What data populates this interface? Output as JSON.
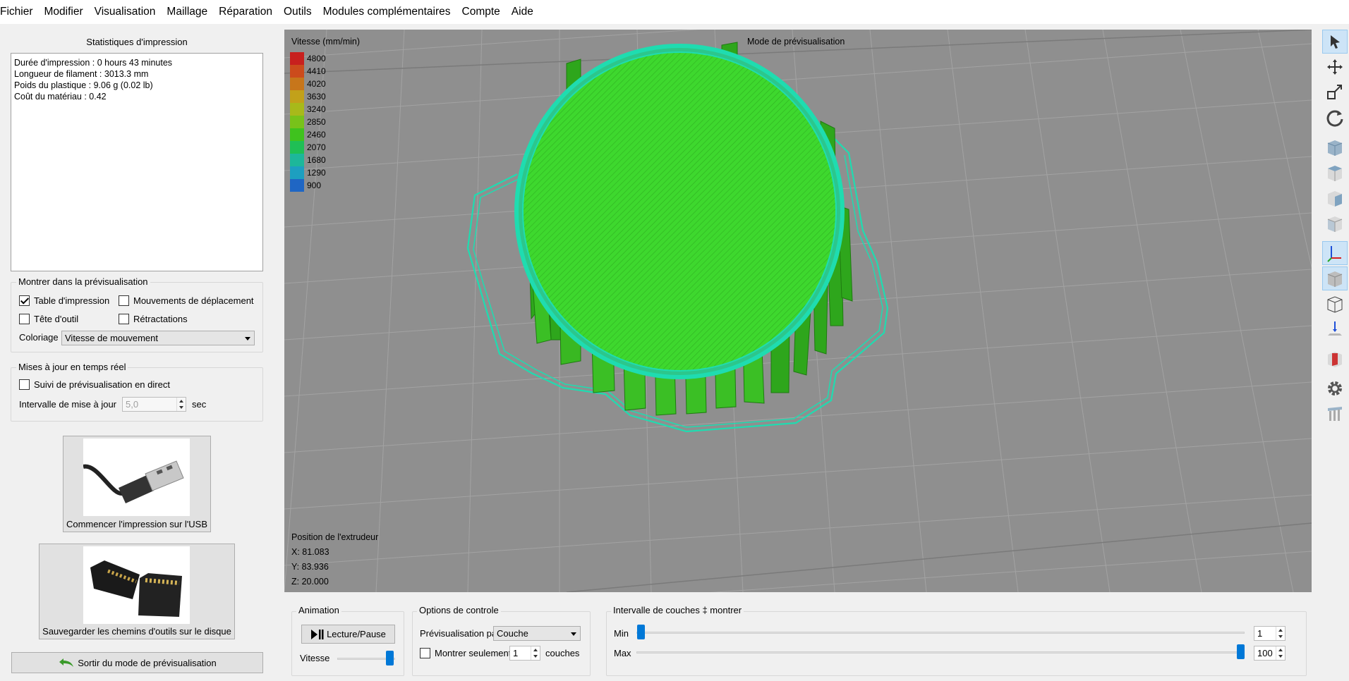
{
  "menu": [
    "Fichier",
    "Modifier",
    "Visualisation",
    "Maillage",
    "Réparation",
    "Outils",
    "Modules complémentaires",
    "Compte",
    "Aide"
  ],
  "stats": {
    "title": "Statistiques d'impression",
    "lines": [
      "Durée d'impression : 0 hours 43 minutes",
      "Longueur de filament : 3013.3 mm",
      "Poids du plastique : 9.06 g (0.02 lb)",
      "Coût du matériau : 0.42"
    ]
  },
  "preview_show": {
    "title": "Montrer dans la prévisualisation",
    "print_bed": {
      "label": "Table d'impression",
      "checked": true
    },
    "travel_moves": {
      "label": "Mouvements de déplacement",
      "checked": false
    },
    "tool_head": {
      "label": "Tête d'outil",
      "checked": false
    },
    "retractions": {
      "label": "Rétractations",
      "checked": false
    },
    "coloring_label": "Coloriage",
    "coloring_value": "Vitesse de mouvement"
  },
  "realtime": {
    "title": "Mises à jour en temps réel",
    "live_label": "Suivi de prévisualisation en direct",
    "interval_label": "Intervalle de mise à jour",
    "interval_value": "5,0",
    "interval_unit": "sec"
  },
  "usb_button": "Commencer l'impression sur l'USB",
  "save_button": "Sauvegarder les chemins d'outils sur le disque",
  "exit_button": "Sortir du mode de prévisualisation",
  "viewport": {
    "legend_title": "Vitesse (mm/min)",
    "mode_label": "Mode de prévisualisation",
    "legend": [
      {
        "label": "4800",
        "color": "#c8201e"
      },
      {
        "label": "4410",
        "color": "#cc4b1c"
      },
      {
        "label": "4020",
        "color": "#c7761b"
      },
      {
        "label": "3630",
        "color": "#c2a11a"
      },
      {
        "label": "3240",
        "color": "#a8b91a"
      },
      {
        "label": "2850",
        "color": "#78c21a"
      },
      {
        "label": "2460",
        "color": "#3fc21e"
      },
      {
        "label": "2070",
        "color": "#1fbf55"
      },
      {
        "label": "1680",
        "color": "#1db79a"
      },
      {
        "label": "1290",
        "color": "#1d9fc0"
      },
      {
        "label": "900",
        "color": "#1f66c4"
      }
    ],
    "extruder": {
      "title": "Position de l'extrudeur",
      "x": "X: 81.083",
      "y": "Y: 83.936",
      "z": "Z: 20.000"
    }
  },
  "animation": {
    "title": "Animation",
    "play_label": "Lecture/Pause",
    "speed_label": "Vitesse",
    "speed_fraction": 0.9
  },
  "control": {
    "title": "Options de controle",
    "preview_by_label": "Prévisualisation par",
    "preview_by_value": "Couche",
    "show_only_label": "Montrer seulement",
    "show_only_value": "1",
    "layers_label": "couches"
  },
  "layers": {
    "title": "Intervalle de couches ‡ montrer",
    "min_label": "Min",
    "max_label": "Max",
    "min_value": "1",
    "max_value": "100"
  }
}
